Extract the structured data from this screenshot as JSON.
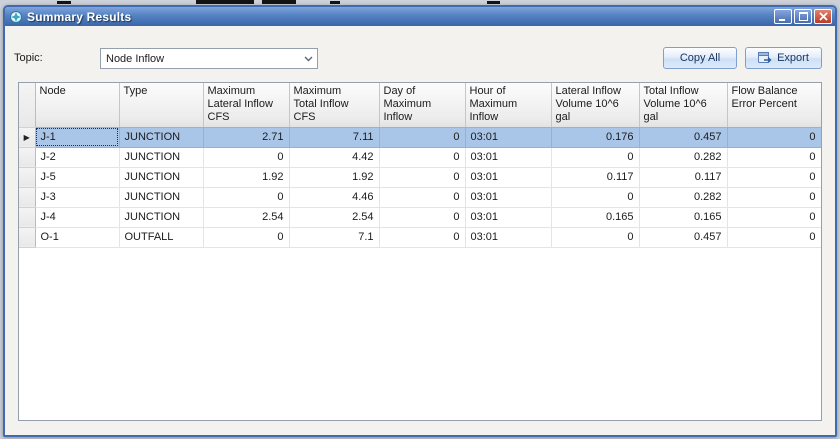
{
  "window": {
    "title": "Summary Results"
  },
  "toolbar": {
    "topic_label": "Topic:",
    "topic_value": "Node Inflow",
    "copy_all_label": "Copy All",
    "export_label": "Export"
  },
  "grid": {
    "columns": [
      "Node",
      "Type",
      "Maximum\nLateral Inflow\nCFS",
      "Maximum\nTotal Inflow\nCFS",
      "Day of\nMaximum\nInflow",
      "Hour of\nMaximum\nInflow",
      "Lateral Inflow\nVolume 10^6\ngal",
      "Total Inflow\nVolume 10^6\ngal",
      "Flow Balance\nError Percent"
    ],
    "selected_row_index": 0,
    "selection_marker": "▶",
    "rows": [
      {
        "cells": [
          "J-1",
          "JUNCTION",
          "2.71",
          "7.11",
          "0",
          "03:01",
          "0.176",
          "0.457",
          "0"
        ]
      },
      {
        "cells": [
          "J-2",
          "JUNCTION",
          "0",
          "4.42",
          "0",
          "03:01",
          "0",
          "0.282",
          "0"
        ]
      },
      {
        "cells": [
          "J-5",
          "JUNCTION",
          "1.92",
          "1.92",
          "0",
          "03:01",
          "0.117",
          "0.117",
          "0"
        ]
      },
      {
        "cells": [
          "J-3",
          "JUNCTION",
          "0",
          "4.46",
          "0",
          "03:01",
          "0",
          "0.282",
          "0"
        ]
      },
      {
        "cells": [
          "J-4",
          "JUNCTION",
          "2.54",
          "2.54",
          "0",
          "03:01",
          "0.165",
          "0.165",
          "0"
        ]
      },
      {
        "cells": [
          "O-1",
          "OUTFALL",
          "0",
          "7.1",
          "0",
          "03:01",
          "0",
          "0.457",
          "0"
        ]
      }
    ]
  },
  "colors": {
    "titlebar_blue": "#3a66a8",
    "selection_blue": "#a9c6e9",
    "button_border_blue": "#7da0cf"
  }
}
